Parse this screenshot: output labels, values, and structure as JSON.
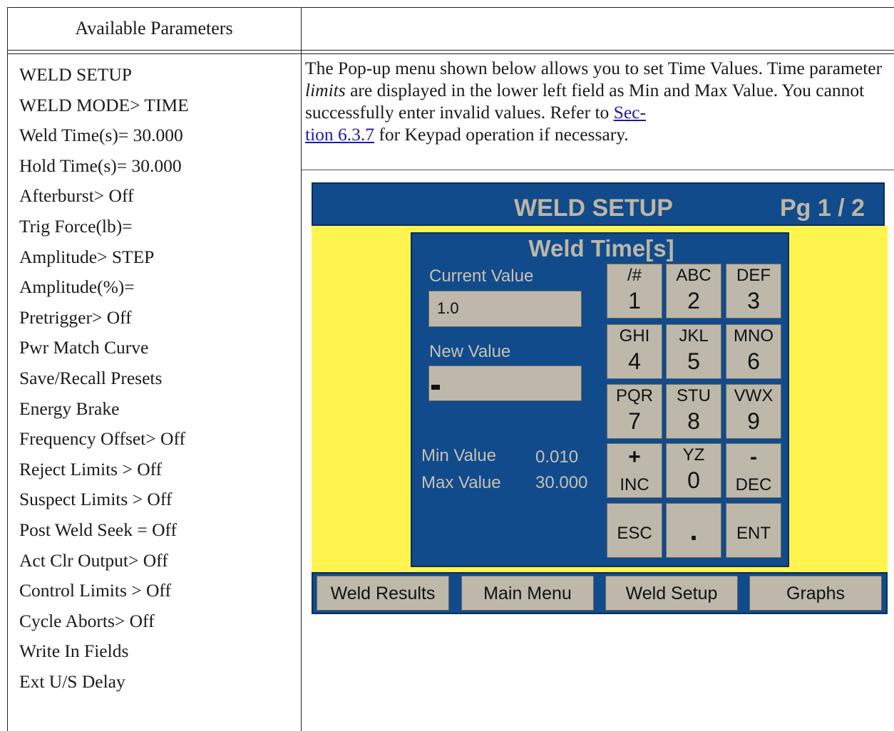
{
  "table": {
    "header_left": "Available Parameters",
    "parameters": [
      "WELD SETUP",
      "WELD MODE> TIME",
      "Weld Time(s)= 30.000",
      "Hold Time(s)= 30.000",
      "Afterburst> Off",
      "Trig Force(lb)=",
      "Amplitude> STEP",
      "Amplitude(%)=",
      "Pretrigger> Off",
      "Pwr Match Curve",
      "Save/Recall Presets",
      "Energy Brake",
      "Frequency Offset> Off",
      "Reject Limits > Off",
      "Suspect Limits > Off",
      "Post Weld Seek = Off",
      "Act Clr Output> Off",
      "Control Limits > Off",
      "Cycle Aborts> Off",
      "Write In Fields",
      "Ext U/S Delay"
    ]
  },
  "description": {
    "part1": "The Pop-up menu shown below allows you to set Time Values. Time parameter ",
    "emphasis": "limits",
    "part2": " are displayed in the lower left field as Min and Max Value. You cannot successfully enter invalid values. Refer to ",
    "link_line1": "Sec-",
    "link_line2": "tion 6.3.7",
    "part3": " for Keypad operation if necessary."
  },
  "screen": {
    "title": "WELD SETUP",
    "page": "Pg 1 / 2",
    "popup": {
      "title": "Weld Time[s]",
      "current_label": "Current Value",
      "current_value": "1.0",
      "new_label": "New Value",
      "min_label": "Min Value",
      "min_value": "0.010",
      "max_label": "Max Value",
      "max_value": "30.000"
    },
    "keys": [
      {
        "top": "/#",
        "bottom": "1"
      },
      {
        "top": "ABC",
        "bottom": "2"
      },
      {
        "top": "DEF",
        "bottom": "3"
      },
      {
        "top": "GHI",
        "bottom": "4"
      },
      {
        "top": "JKL",
        "bottom": "5"
      },
      {
        "top": "MNO",
        "bottom": "6"
      },
      {
        "top": "PQR",
        "bottom": "7"
      },
      {
        "top": "STU",
        "bottom": "8"
      },
      {
        "top": "VWX",
        "bottom": "9"
      },
      {
        "top": "+",
        "bottom": "INC"
      },
      {
        "top": "YZ",
        "bottom": "0"
      },
      {
        "top": "-",
        "bottom": "DEC"
      },
      {
        "top": "",
        "bottom": "ESC"
      },
      {
        "top": "",
        "bottom": "."
      },
      {
        "top": "",
        "bottom": "ENT"
      }
    ],
    "nav": [
      "Weld Results",
      "Main Menu",
      "Weld Setup",
      "Graphs"
    ]
  }
}
